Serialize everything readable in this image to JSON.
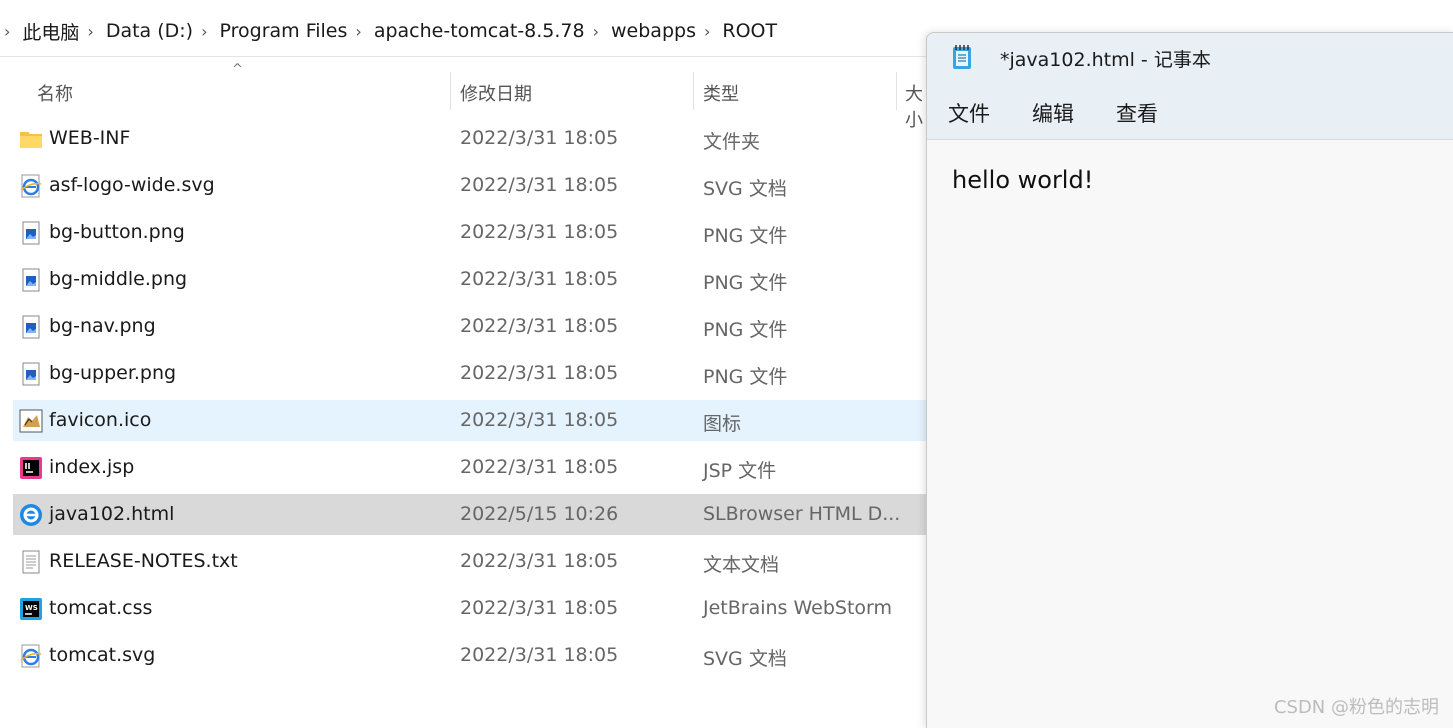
{
  "breadcrumb": [
    "此电脑",
    "Data (D:)",
    "Program Files",
    "apache-tomcat-8.5.78",
    "webapps",
    "ROOT"
  ],
  "columns": {
    "name": "名称",
    "modified": "修改日期",
    "type": "类型",
    "size": "大小"
  },
  "files": [
    {
      "name": "WEB-INF",
      "date": "2022/3/31 18:05",
      "type": "文件夹",
      "icon": "folder-icon"
    },
    {
      "name": "asf-logo-wide.svg",
      "date": "2022/3/31 18:05",
      "type": "SVG 文档",
      "icon": "svg-file-icon"
    },
    {
      "name": "bg-button.png",
      "date": "2022/3/31 18:05",
      "type": "PNG 文件",
      "icon": "image-file-icon"
    },
    {
      "name": "bg-middle.png",
      "date": "2022/3/31 18:05",
      "type": "PNG 文件",
      "icon": "image-file-icon"
    },
    {
      "name": "bg-nav.png",
      "date": "2022/3/31 18:05",
      "type": "PNG 文件",
      "icon": "image-file-icon"
    },
    {
      "name": "bg-upper.png",
      "date": "2022/3/31 18:05",
      "type": "PNG 文件",
      "icon": "image-file-icon"
    },
    {
      "name": "favicon.ico",
      "date": "2022/3/31 18:05",
      "type": "图标",
      "icon": "ico-file-icon"
    },
    {
      "name": "index.jsp",
      "date": "2022/3/31 18:05",
      "type": "JSP 文件",
      "icon": "intellij-file-icon"
    },
    {
      "name": "java102.html",
      "date": "2022/5/15 10:26",
      "type": "SLBrowser HTML D...",
      "icon": "browser-html-icon"
    },
    {
      "name": "RELEASE-NOTES.txt",
      "date": "2022/3/31 18:05",
      "type": "文本文档",
      "icon": "text-file-icon"
    },
    {
      "name": "tomcat.css",
      "date": "2022/3/31 18:05",
      "type": "JetBrains WebStorm",
      "icon": "webstorm-file-icon"
    },
    {
      "name": "tomcat.svg",
      "date": "2022/3/31 18:05",
      "type": "SVG 文档",
      "icon": "svg-file-icon"
    }
  ],
  "notepad": {
    "title": "*java102.html - 记事本",
    "menu": [
      "文件",
      "编辑",
      "查看"
    ],
    "content": "hello world!"
  },
  "watermark": "CSDN @粉色的志明"
}
